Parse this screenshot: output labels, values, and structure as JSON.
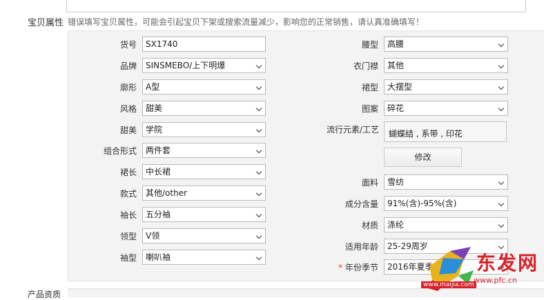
{
  "section": {
    "title": "宝贝属性",
    "notice": "错误填写宝贝属性，可能会引起宝贝下架或搜索流量减少，影响您的正常销售，请认真准确填写！"
  },
  "left_fields": [
    {
      "label": "货号",
      "value": "SX1740",
      "type": "input"
    },
    {
      "label": "品牌",
      "value": "SINSMEBO/上下明爆",
      "type": "select"
    },
    {
      "label": "廓形",
      "value": "A型",
      "type": "select"
    },
    {
      "label": "风格",
      "value": "甜美",
      "type": "select"
    },
    {
      "label": "甜美",
      "value": "学院",
      "type": "select"
    },
    {
      "label": "组合形式",
      "value": "两件套",
      "type": "select"
    },
    {
      "label": "裙长",
      "value": "中长裙",
      "type": "select"
    },
    {
      "label": "款式",
      "value": "其他/other",
      "type": "select"
    },
    {
      "label": "袖长",
      "value": "五分袖",
      "type": "select"
    },
    {
      "label": "领型",
      "value": "V领",
      "type": "select"
    },
    {
      "label": "袖型",
      "value": "喇叭袖",
      "type": "select"
    }
  ],
  "right_fields_top": [
    {
      "label": "腰型",
      "value": "高腰"
    },
    {
      "label": "衣门襟",
      "value": "其他"
    },
    {
      "label": "裙型",
      "value": "大摆型"
    },
    {
      "label": "图案",
      "value": "碎花"
    }
  ],
  "trend": {
    "label": "流行元素/工艺",
    "value": "蝴蝶结 , 系带 , 印花",
    "button": "修改"
  },
  "right_fields_bottom": [
    {
      "label": "面料",
      "value": "雪纺"
    },
    {
      "label": "成分含量",
      "value": "91%(含)-95%(含)"
    },
    {
      "label": "材质",
      "value": "涤纶"
    },
    {
      "label": "适用年龄",
      "value": "25-29周岁"
    },
    {
      "label": "年份季节",
      "value": "2016年夏季",
      "required": "*"
    }
  ],
  "bottom_label": "产品资质",
  "watermark": {
    "text": "东发网",
    "url": "www.pfc.cn",
    "url2": "www.maijia.com"
  },
  "colors": {
    "required": "#e4393c",
    "panel": "#f3f3f3",
    "watermark": "#d7222b"
  }
}
